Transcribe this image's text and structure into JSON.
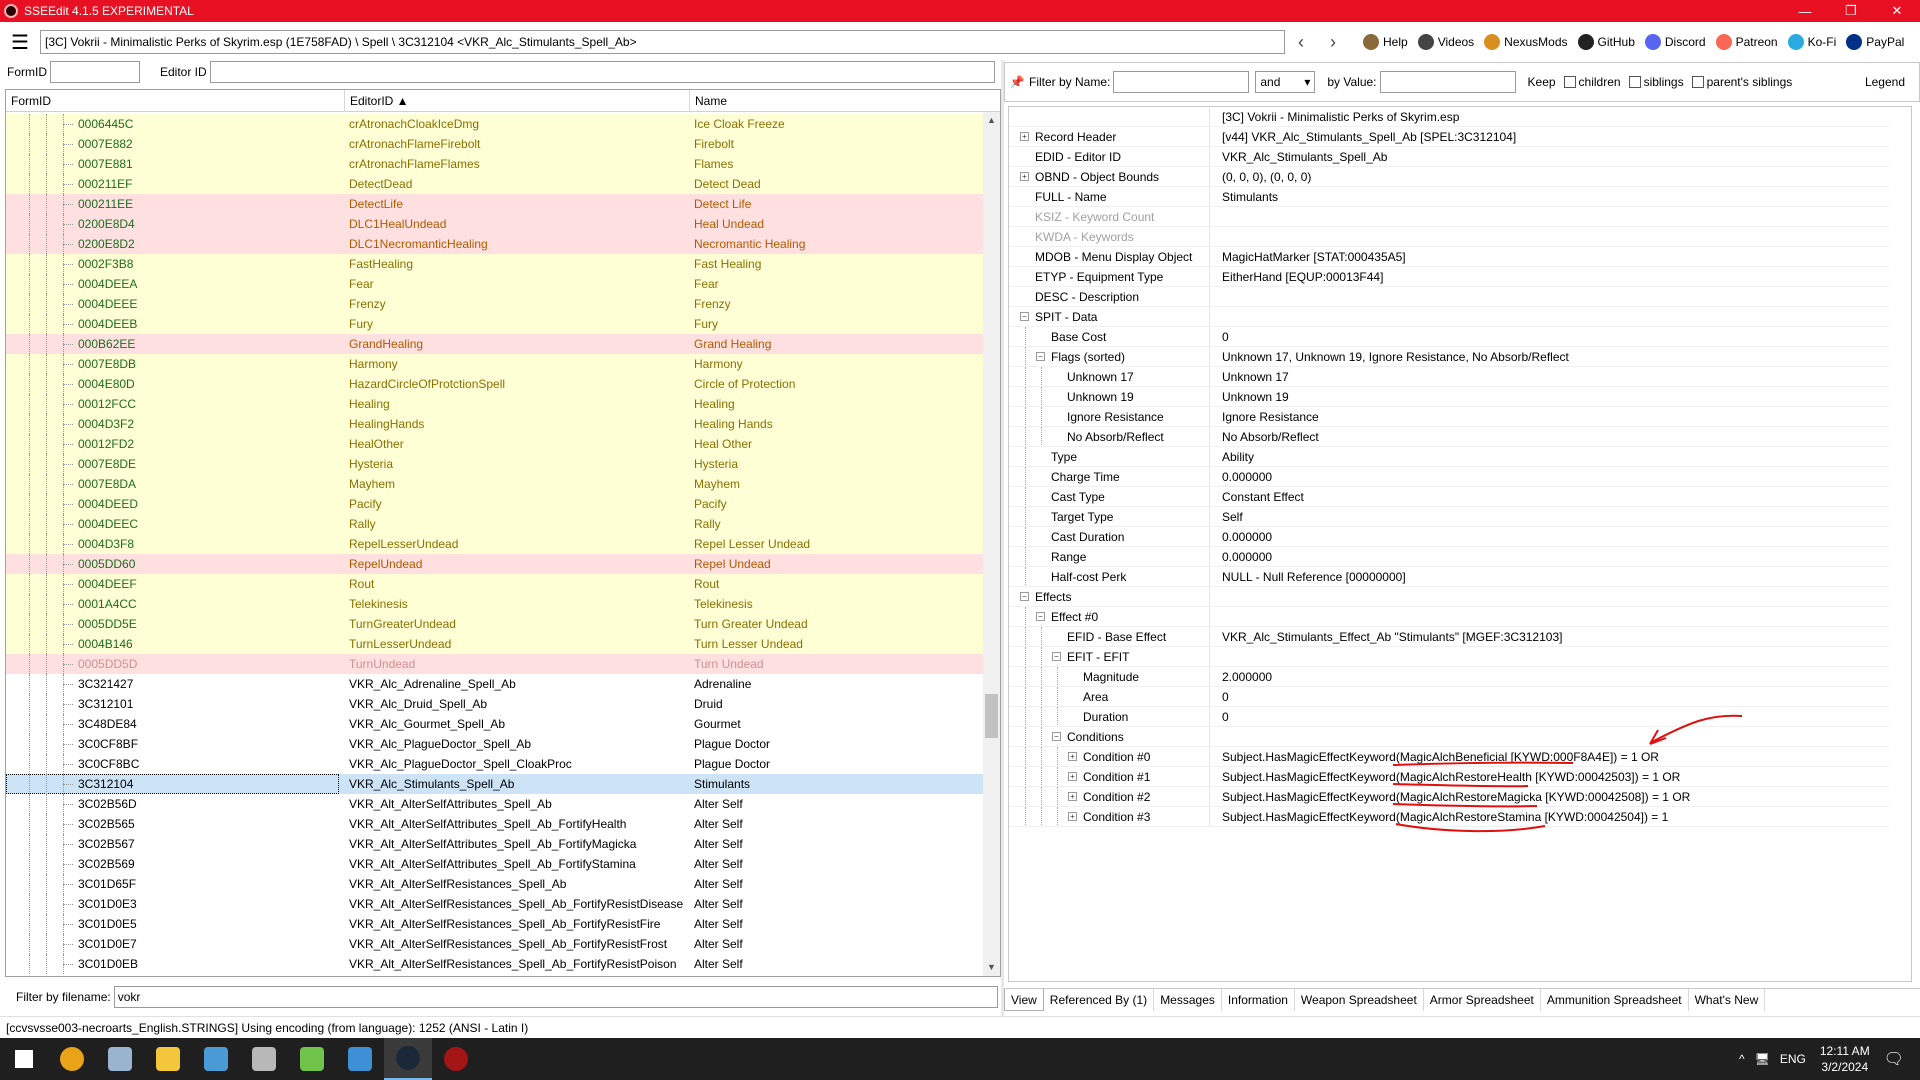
{
  "window": {
    "title": "SSEEdit 4.1.5 EXPERIMENTAL",
    "minimize": "—",
    "maximize": "❐",
    "close": "✕"
  },
  "toolbar": {
    "menu_icon": "hamburger-icon",
    "path": "[3C] Vokrii - Minimalistic Perks of Skyrim.esp (1E758FAD) \\ Spell \\ 3C312104 <VKR_Alc_Stimulants_Spell_Ab>",
    "back": "‹",
    "forward": "›",
    "links": [
      {
        "label": "Help",
        "icon": "book-icon",
        "color": "#8a6a3a"
      },
      {
        "label": "Videos",
        "icon": "film-icon",
        "color": "#444444"
      },
      {
        "label": "NexusMods",
        "icon": "nexus-icon",
        "color": "#d98f20"
      },
      {
        "label": "GitHub",
        "icon": "github-icon",
        "color": "#222222"
      },
      {
        "label": "Discord",
        "icon": "discord-icon",
        "color": "#5865f2"
      },
      {
        "label": "Patreon",
        "icon": "patreon-icon",
        "color": "#f96854"
      },
      {
        "label": "Ko-Fi",
        "icon": "kofi-icon",
        "color": "#29abe0"
      },
      {
        "label": "PayPal",
        "icon": "paypal-icon",
        "color": "#003087"
      }
    ]
  },
  "left_filter": {
    "formid_label": "FormID",
    "formid_value": "",
    "editorid_label": "Editor ID",
    "editorid_value": ""
  },
  "grid": {
    "columns": [
      "FormID",
      "EditorID ▲",
      "Name"
    ],
    "rows": [
      {
        "formid": "0006445C",
        "editorid": "crAtronachCloakIceDmg",
        "name": "Ice Cloak Freeze",
        "style": "yellow"
      },
      {
        "formid": "0007E882",
        "editorid": "crAtronachFlameFirebolt",
        "name": "Firebolt",
        "style": "yellow"
      },
      {
        "formid": "0007E881",
        "editorid": "crAtronachFlameFlames",
        "name": "Flames",
        "style": "yellow"
      },
      {
        "formid": "000211EF",
        "editorid": "DetectDead",
        "name": "Detect Dead",
        "style": "yellow"
      },
      {
        "formid": "000211EE",
        "editorid": "DetectLife",
        "name": "Detect Life",
        "style": "pink"
      },
      {
        "formid": "0200E8D4",
        "editorid": "DLC1HealUndead",
        "name": "Heal Undead",
        "style": "pink"
      },
      {
        "formid": "0200E8D2",
        "editorid": "DLC1NecromanticHealing",
        "name": "Necromantic Healing",
        "style": "pink"
      },
      {
        "formid": "0002F3B8",
        "editorid": "FastHealing",
        "name": "Fast Healing",
        "style": "yellow"
      },
      {
        "formid": "0004DEEA",
        "editorid": "Fear",
        "name": "Fear",
        "style": "yellow"
      },
      {
        "formid": "0004DEEE",
        "editorid": "Frenzy",
        "name": "Frenzy",
        "style": "yellow"
      },
      {
        "formid": "0004DEEB",
        "editorid": "Fury",
        "name": "Fury",
        "style": "yellow"
      },
      {
        "formid": "000B62EE",
        "editorid": "GrandHealing",
        "name": "Grand Healing",
        "style": "pink"
      },
      {
        "formid": "0007E8DB",
        "editorid": "Harmony",
        "name": "Harmony",
        "style": "yellow"
      },
      {
        "formid": "0004E80D",
        "editorid": "HazardCircleOfProtctionSpell",
        "name": "Circle of Protection",
        "style": "yellow"
      },
      {
        "formid": "00012FCC",
        "editorid": "Healing",
        "name": "Healing",
        "style": "yellow"
      },
      {
        "formid": "0004D3F2",
        "editorid": "HealingHands",
        "name": "Healing Hands",
        "style": "yellow"
      },
      {
        "formid": "00012FD2",
        "editorid": "HealOther",
        "name": "Heal Other",
        "style": "yellow"
      },
      {
        "formid": "0007E8DE",
        "editorid": "Hysteria",
        "name": "Hysteria",
        "style": "yellow"
      },
      {
        "formid": "0007E8DA",
        "editorid": "Mayhem",
        "name": "Mayhem",
        "style": "yellow"
      },
      {
        "formid": "0004DEED",
        "editorid": "Pacify",
        "name": "Pacify",
        "style": "yellow"
      },
      {
        "formid": "0004DEEC",
        "editorid": "Rally",
        "name": "Rally",
        "style": "yellow"
      },
      {
        "formid": "0004D3F8",
        "editorid": "RepelLesserUndead",
        "name": "Repel Lesser Undead",
        "style": "yellow"
      },
      {
        "formid": "0005DD60",
        "editorid": "RepelUndead",
        "name": "Repel Undead",
        "style": "pink"
      },
      {
        "formid": "0004DEEF",
        "editorid": "Rout",
        "name": "Rout",
        "style": "yellow"
      },
      {
        "formid": "0001A4CC",
        "editorid": "Telekinesis",
        "name": "Telekinesis",
        "style": "yellow"
      },
      {
        "formid": "0005DD5E",
        "editorid": "TurnGreaterUndead",
        "name": "Turn Greater Undead",
        "style": "yellow"
      },
      {
        "formid": "0004B146",
        "editorid": "TurnLesserUndead",
        "name": "Turn Lesser Undead",
        "style": "yellow"
      },
      {
        "formid": "0005DD5D",
        "editorid": "TurnUndead",
        "name": "Turn Undead",
        "style": "pinklight"
      },
      {
        "formid": "3C321427",
        "editorid": "VKR_Alc_Adrenaline_Spell_Ab",
        "name": "Adrenaline",
        "style": "white"
      },
      {
        "formid": "3C312101",
        "editorid": "VKR_Alc_Druid_Spell_Ab",
        "name": "Druid",
        "style": "white"
      },
      {
        "formid": "3C48DE84",
        "editorid": "VKR_Alc_Gourmet_Spell_Ab",
        "name": "Gourmet",
        "style": "white"
      },
      {
        "formid": "3C0CF8BF",
        "editorid": "VKR_Alc_PlagueDoctor_Spell_Ab",
        "name": "Plague Doctor",
        "style": "white"
      },
      {
        "formid": "3C0CF8BC",
        "editorid": "VKR_Alc_PlagueDoctor_Spell_CloakProc",
        "name": "Plague Doctor",
        "style": "white"
      },
      {
        "formid": "3C312104",
        "editorid": "VKR_Alc_Stimulants_Spell_Ab",
        "name": "Stimulants",
        "style": "selected"
      },
      {
        "formid": "3C02B56D",
        "editorid": "VKR_Alt_AlterSelfAttributes_Spell_Ab",
        "name": "Alter Self",
        "style": "white"
      },
      {
        "formid": "3C02B565",
        "editorid": "VKR_Alt_AlterSelfAttributes_Spell_Ab_FortifyHealth",
        "name": "Alter Self",
        "style": "white"
      },
      {
        "formid": "3C02B567",
        "editorid": "VKR_Alt_AlterSelfAttributes_Spell_Ab_FortifyMagicka",
        "name": "Alter Self",
        "style": "white"
      },
      {
        "formid": "3C02B569",
        "editorid": "VKR_Alt_AlterSelfAttributes_Spell_Ab_FortifyStamina",
        "name": "Alter Self",
        "style": "white"
      },
      {
        "formid": "3C01D65F",
        "editorid": "VKR_Alt_AlterSelfResistances_Spell_Ab",
        "name": "Alter Self",
        "style": "white"
      },
      {
        "formid": "3C01D0E3",
        "editorid": "VKR_Alt_AlterSelfResistances_Spell_Ab_FortifyResistDisease",
        "name": "Alter Self",
        "style": "white"
      },
      {
        "formid": "3C01D0E5",
        "editorid": "VKR_Alt_AlterSelfResistances_Spell_Ab_FortifyResistFire",
        "name": "Alter Self",
        "style": "white"
      },
      {
        "formid": "3C01D0E7",
        "editorid": "VKR_Alt_AlterSelfResistances_Spell_Ab_FortifyResistFrost",
        "name": "Alter Self",
        "style": "white"
      },
      {
        "formid": "3C01D0EB",
        "editorid": "VKR_Alt_AlterSelfResistances_Spell_Ab_FortifyResistPoison",
        "name": "Alter Self",
        "style": "white"
      }
    ],
    "scroll_up": "▲",
    "scroll_down": "▼"
  },
  "file_filter": {
    "label": "Filter by filename:",
    "value": "vokr"
  },
  "right_filter": {
    "name_label": "Filter by Name:",
    "name_value": "",
    "operator": "and",
    "value_label": "by Value:",
    "value_value": "",
    "keep_label": "Keep",
    "children_label": "children",
    "siblings_label": "siblings",
    "parents_label": "parent's siblings",
    "legend_label": "Legend"
  },
  "record": {
    "file_header": "[3C] Vokrii - Minimalistic Perks of Skyrim.esp",
    "rows": [
      {
        "label": "Record Header",
        "value": "[v44] VKR_Alc_Stimulants_Spell_Ab [SPEL:3C312104]",
        "depth": 0,
        "exp": "+"
      },
      {
        "label": "EDID - Editor ID",
        "value": "VKR_Alc_Stimulants_Spell_Ab",
        "depth": 0,
        "exp": ""
      },
      {
        "label": "OBND - Object Bounds",
        "value": "(0, 0, 0), (0, 0, 0)",
        "depth": 0,
        "exp": "+"
      },
      {
        "label": "FULL - Name",
        "value": "Stimulants",
        "depth": 0,
        "exp": ""
      },
      {
        "label": "KSIZ - Keyword Count",
        "value": "",
        "depth": 0,
        "exp": "",
        "grey": true
      },
      {
        "label": "KWDA - Keywords",
        "value": "",
        "depth": 0,
        "exp": "",
        "grey": true
      },
      {
        "label": "MDOB - Menu Display Object",
        "value": "MagicHatMarker [STAT:000435A5]",
        "depth": 0,
        "exp": ""
      },
      {
        "label": "ETYP - Equipment Type",
        "value": "EitherHand [EQUP:00013F44]",
        "depth": 0,
        "exp": ""
      },
      {
        "label": "DESC - Description",
        "value": "",
        "depth": 0,
        "exp": ""
      },
      {
        "label": "SPIT - Data",
        "value": "",
        "depth": 0,
        "exp": "−"
      },
      {
        "label": "Base Cost",
        "value": "0",
        "depth": 1,
        "exp": ""
      },
      {
        "label": "Flags (sorted)",
        "value": "Unknown 17, Unknown 19, Ignore Resistance, No Absorb/Reflect",
        "depth": 1,
        "exp": "−"
      },
      {
        "label": "Unknown 17",
        "value": "Unknown 17",
        "depth": 2,
        "exp": ""
      },
      {
        "label": "Unknown 19",
        "value": "Unknown 19",
        "depth": 2,
        "exp": ""
      },
      {
        "label": "Ignore Resistance",
        "value": "Ignore Resistance",
        "depth": 2,
        "exp": ""
      },
      {
        "label": "No Absorb/Reflect",
        "value": "No Absorb/Reflect",
        "depth": 2,
        "exp": ""
      },
      {
        "label": "Type",
        "value": "Ability",
        "depth": 1,
        "exp": ""
      },
      {
        "label": "Charge Time",
        "value": "0.000000",
        "depth": 1,
        "exp": ""
      },
      {
        "label": "Cast Type",
        "value": "Constant Effect",
        "depth": 1,
        "exp": ""
      },
      {
        "label": "Target Type",
        "value": "Self",
        "depth": 1,
        "exp": ""
      },
      {
        "label": "Cast Duration",
        "value": "0.000000",
        "depth": 1,
        "exp": ""
      },
      {
        "label": "Range",
        "value": "0.000000",
        "depth": 1,
        "exp": ""
      },
      {
        "label": "Half-cost Perk",
        "value": "NULL - Null Reference [00000000]",
        "depth": 1,
        "exp": ""
      },
      {
        "label": "Effects",
        "value": "",
        "depth": 0,
        "exp": "−"
      },
      {
        "label": "Effect #0",
        "value": "",
        "depth": 1,
        "exp": "−"
      },
      {
        "label": "EFID - Base Effect",
        "value": "VKR_Alc_Stimulants_Effect_Ab \"Stimulants\" [MGEF:3C312103]",
        "depth": 2,
        "exp": ""
      },
      {
        "label": "EFIT - EFIT",
        "value": "",
        "depth": 2,
        "exp": "−"
      },
      {
        "label": "Magnitude",
        "value": "2.000000",
        "depth": 3,
        "exp": ""
      },
      {
        "label": "Area",
        "value": "0",
        "depth": 3,
        "exp": ""
      },
      {
        "label": "Duration",
        "value": "0",
        "depth": 3,
        "exp": ""
      },
      {
        "label": "Conditions",
        "value": "",
        "depth": 2,
        "exp": "−"
      },
      {
        "label": "Condition #0",
        "value": "Subject.HasMagicEffectKeyword(MagicAlchBeneficial [KYWD:000F8A4E]) = 1 OR",
        "depth": 3,
        "exp": "+"
      },
      {
        "label": "Condition #1",
        "value": "Subject.HasMagicEffectKeyword(MagicAlchRestoreHealth [KYWD:00042503]) = 1 OR",
        "depth": 3,
        "exp": "+"
      },
      {
        "label": "Condition #2",
        "value": "Subject.HasMagicEffectKeyword(MagicAlchRestoreMagicka [KYWD:00042508]) = 1 OR",
        "depth": 3,
        "exp": "+"
      },
      {
        "label": "Condition #3",
        "value": "Subject.HasMagicEffectKeyword(MagicAlchRestoreStamina [KYWD:00042504]) = 1",
        "depth": 3,
        "exp": "+"
      }
    ]
  },
  "tabs": [
    {
      "label": "View",
      "active": true
    },
    {
      "label": "Referenced By (1)",
      "active": false
    },
    {
      "label": "Messages",
      "active": false
    },
    {
      "label": "Information",
      "active": false
    },
    {
      "label": "Weapon Spreadsheet",
      "active": false
    },
    {
      "label": "Armor Spreadsheet",
      "active": false
    },
    {
      "label": "Ammunition Spreadsheet",
      "active": false
    },
    {
      "label": "What's New",
      "active": false
    }
  ],
  "status": "[ccvsvsse003-necroarts_English.STRINGS] Using encoding (from language): 1252  (ANSI - Latin I)",
  "taskbar": {
    "apps": [
      {
        "icon": "windows-start-icon",
        "color": "#ffffff"
      },
      {
        "icon": "chrome-icon",
        "color": "#e8a317"
      },
      {
        "icon": "steam-icon",
        "color": "#9ab4cf"
      },
      {
        "icon": "file-explorer-icon",
        "color": "#f3c63b"
      },
      {
        "icon": "control-panel-icon",
        "color": "#4a9ad6"
      },
      {
        "icon": "app-tool-icon",
        "color": "#b8b8b8"
      },
      {
        "icon": "vortex-icon",
        "color": "#6fc24a"
      },
      {
        "icon": "folder-app-icon",
        "color": "#3d8fd6"
      },
      {
        "icon": "steam-active-icon",
        "color": "#1b2838"
      },
      {
        "icon": "sseedit-icon",
        "color": "#a31515"
      }
    ],
    "tray_chevron": "^",
    "language": "ENG",
    "time": "12:11 AM",
    "date": "3/2/2024",
    "notification_icon": "notification-icon"
  }
}
